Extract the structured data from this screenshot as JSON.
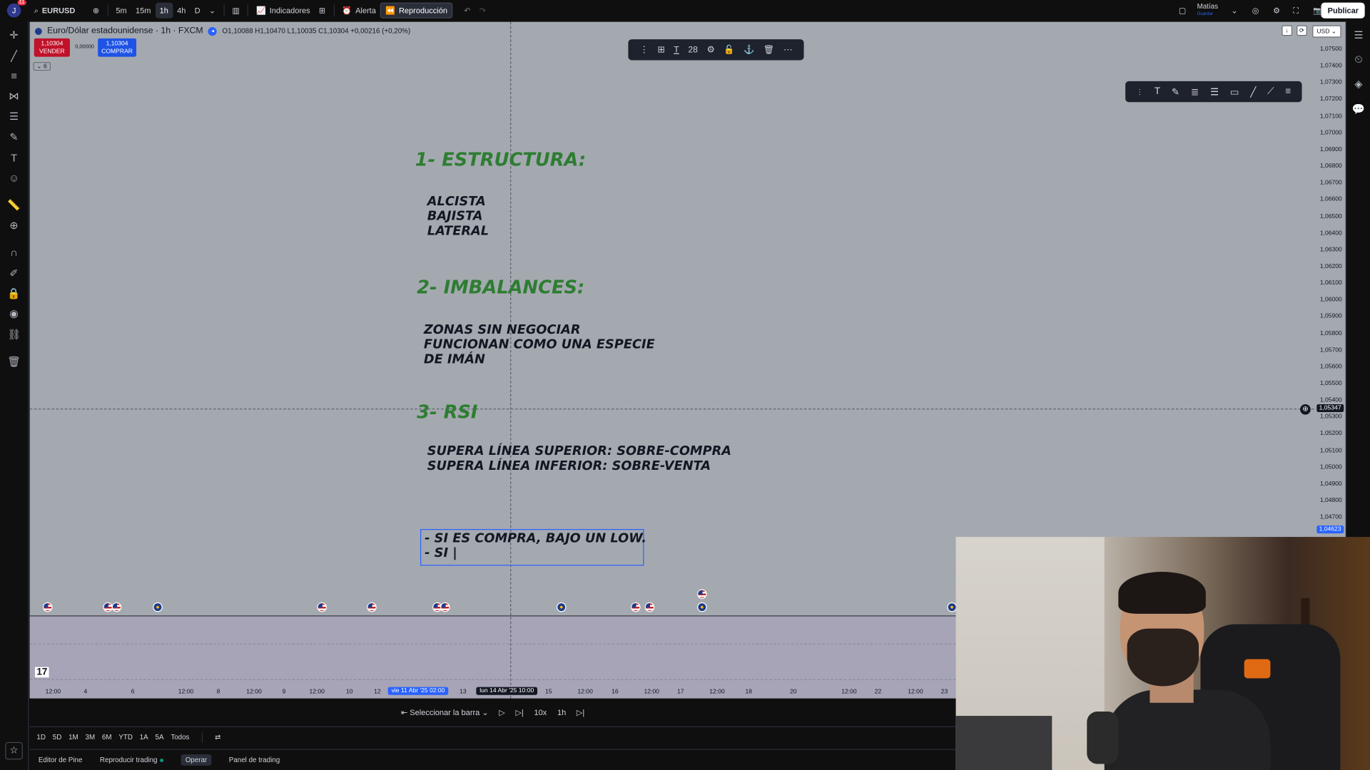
{
  "topbar": {
    "user_initial": "J",
    "notif_count": "11",
    "symbol": "EURUSD",
    "timeframes": [
      "5m",
      "15m",
      "1h",
      "4h",
      "D"
    ],
    "active_timeframe": "1h",
    "indicators": "Indicadores",
    "alert": "Alerta",
    "replay": "Reproducción",
    "user_name": "Matías",
    "user_status": "Guardar",
    "publish": "Publicar"
  },
  "legend": {
    "name": "Euro/Dólar estadounidense · 1h · FXCM",
    "ohlc": "O1,10088 H1,10470 L1,10035 C1,10304 +0,00216 (+0,20%)",
    "sell_price": "1,10304",
    "sell_label": "VENDER",
    "spread": "0,00000",
    "buy_price": "1,10304",
    "buy_label": "COMPRAR",
    "indicators_count": "6"
  },
  "float_toolbar": {
    "font_size": "28"
  },
  "price_axis": {
    "currency": "USD",
    "ticks": [
      "1,07500",
      "1,07400",
      "1,07300",
      "1,07200",
      "1,07100",
      "1,07000",
      "1,06900",
      "1,06800",
      "1,06700",
      "1,06600",
      "1,06500",
      "1,06400",
      "1,06300",
      "1,06200",
      "1,06100",
      "1,06000",
      "1,05900",
      "1,05800",
      "1,05700",
      "1,05600",
      "1,05500",
      "1,05400",
      "1,05300",
      "1,05200",
      "1,05100",
      "1,05000",
      "1,04900",
      "1,04800",
      "1,04700"
    ],
    "crosshair_price": "1,05347",
    "last_price": "1,04623"
  },
  "notes": {
    "h1": "1- ESTRUCTURA:",
    "b1": "ALCISTA\nBAJISTA\nLATERAL",
    "h2": "2- IMBALANCES:",
    "b2": "ZONAS SIN NEGOCIAR\nFUNCIONAN COMO UNA ESPECIE\nDE IMÁN",
    "h3": "3- RSI",
    "b3": "SUPERA LÍNEA SUPERIOR: SOBRE-COMPRA\nSUPERA LÍNEA INFERIOR: SOBRE-VENTA",
    "editing": "- SI ES COMPRA, BAJO UN LOW.\n- SI |"
  },
  "time_axis": {
    "labels": [
      "12:00",
      "4",
      "6",
      "12:00",
      "8",
      "12:00",
      "9",
      "12:00",
      "10",
      "12",
      "13",
      "15",
      "12:00",
      "16",
      "12:00",
      "17",
      "12:00",
      "18",
      "20",
      "12:00",
      "22",
      "12:00",
      "23"
    ],
    "hover_date": "vie 11 Abr '25   02:00",
    "cursor_date": "lun 14 Abr '25   10:00"
  },
  "replay_bar": {
    "select_bar": "Seleccionar la barra",
    "speed": "10x",
    "interval": "1h"
  },
  "ranges": [
    "1D",
    "5D",
    "1M",
    "3M",
    "6M",
    "YTD",
    "1A",
    "5A",
    "Todos"
  ],
  "bottom_tabs": [
    "Editor de Pine",
    "Reproducir trading",
    "Operar",
    "Panel de trading"
  ],
  "logo_text": "17"
}
